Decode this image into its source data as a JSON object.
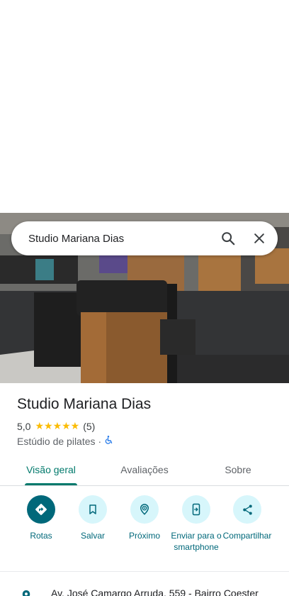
{
  "search": {
    "query": "Studio Mariana Dias"
  },
  "place": {
    "name": "Studio Mariana Dias",
    "rating": "5,0",
    "stars": "★★★★★",
    "review_count": "(5)",
    "category": "Estúdio de pilates",
    "separator": "·"
  },
  "tabs": [
    {
      "label": "Visão geral",
      "active": true
    },
    {
      "label": "Avaliações",
      "active": false
    },
    {
      "label": "Sobre",
      "active": false
    }
  ],
  "actions": [
    {
      "label": "Rotas",
      "icon": "directions-icon"
    },
    {
      "label": "Salvar",
      "icon": "bookmark-icon"
    },
    {
      "label": "Próximo",
      "icon": "nearby-icon"
    },
    {
      "label": "Enviar para o smartphone",
      "icon": "send-to-phone-icon"
    },
    {
      "label": "Compartilhar",
      "icon": "share-icon"
    }
  ],
  "address": {
    "text": "Av. José Camargo Arruda, 559 - Bairro Coester"
  },
  "colors": {
    "accent": "#00687a",
    "tab_active": "#00796b",
    "action_bg": "#d7f6fb",
    "star": "#fbbc04"
  }
}
